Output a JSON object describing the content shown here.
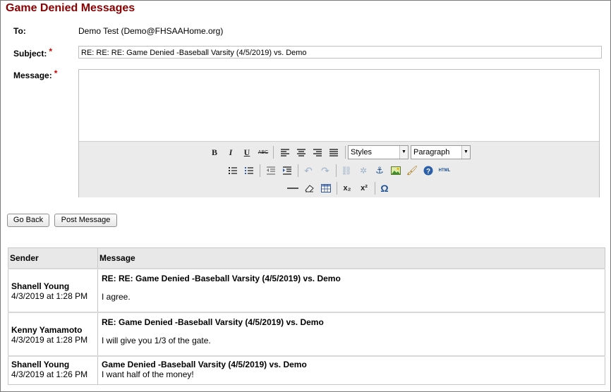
{
  "page": {
    "title": "Game Denied Messages"
  },
  "form": {
    "to_label": "To:",
    "to_value": "Demo Test (Demo@FHSAAHome.org)",
    "subject_label": "Subject:",
    "subject_value": "RE: RE: RE: Game Denied -Baseball Varsity (4/5/2019) vs. Demo",
    "message_label": "Message:",
    "required_mark": "*"
  },
  "editor": {
    "styles_select": "Styles",
    "format_select": "Paragraph",
    "buttons": {
      "bold": "B",
      "italic": "I",
      "underline": "U",
      "strike": "ABC",
      "subscript": "x₂",
      "superscript": "x²",
      "charmap": "Ω",
      "html": "HTML"
    }
  },
  "actions": {
    "go_back": "Go Back",
    "post_message": "Post Message"
  },
  "table": {
    "headers": {
      "sender": "Sender",
      "message": "Message"
    },
    "rows": [
      {
        "sender": "Shanell Young",
        "date": "4/3/2019 at 1:28 PM",
        "subject": "RE: RE: Game Denied -Baseball Varsity (4/5/2019) vs. Demo",
        "body": "I agree."
      },
      {
        "sender": "Kenny Yamamoto",
        "date": "4/3/2019 at 1:28 PM",
        "subject": "RE: Game Denied -Baseball Varsity (4/5/2019) vs. Demo",
        "body": "I will give you 1/3 of the gate."
      },
      {
        "sender": "Shanell Young",
        "date": "4/3/2019 at 1:26 PM",
        "subject": "Game Denied -Baseball Varsity (4/5/2019) vs. Demo",
        "body": "I want half of the money!"
      }
    ]
  },
  "colors": {
    "title": "#8b0000",
    "required": "#cc0000",
    "header_bg": "#e8e8e8",
    "toolbar_bg": "#ebebeb"
  }
}
